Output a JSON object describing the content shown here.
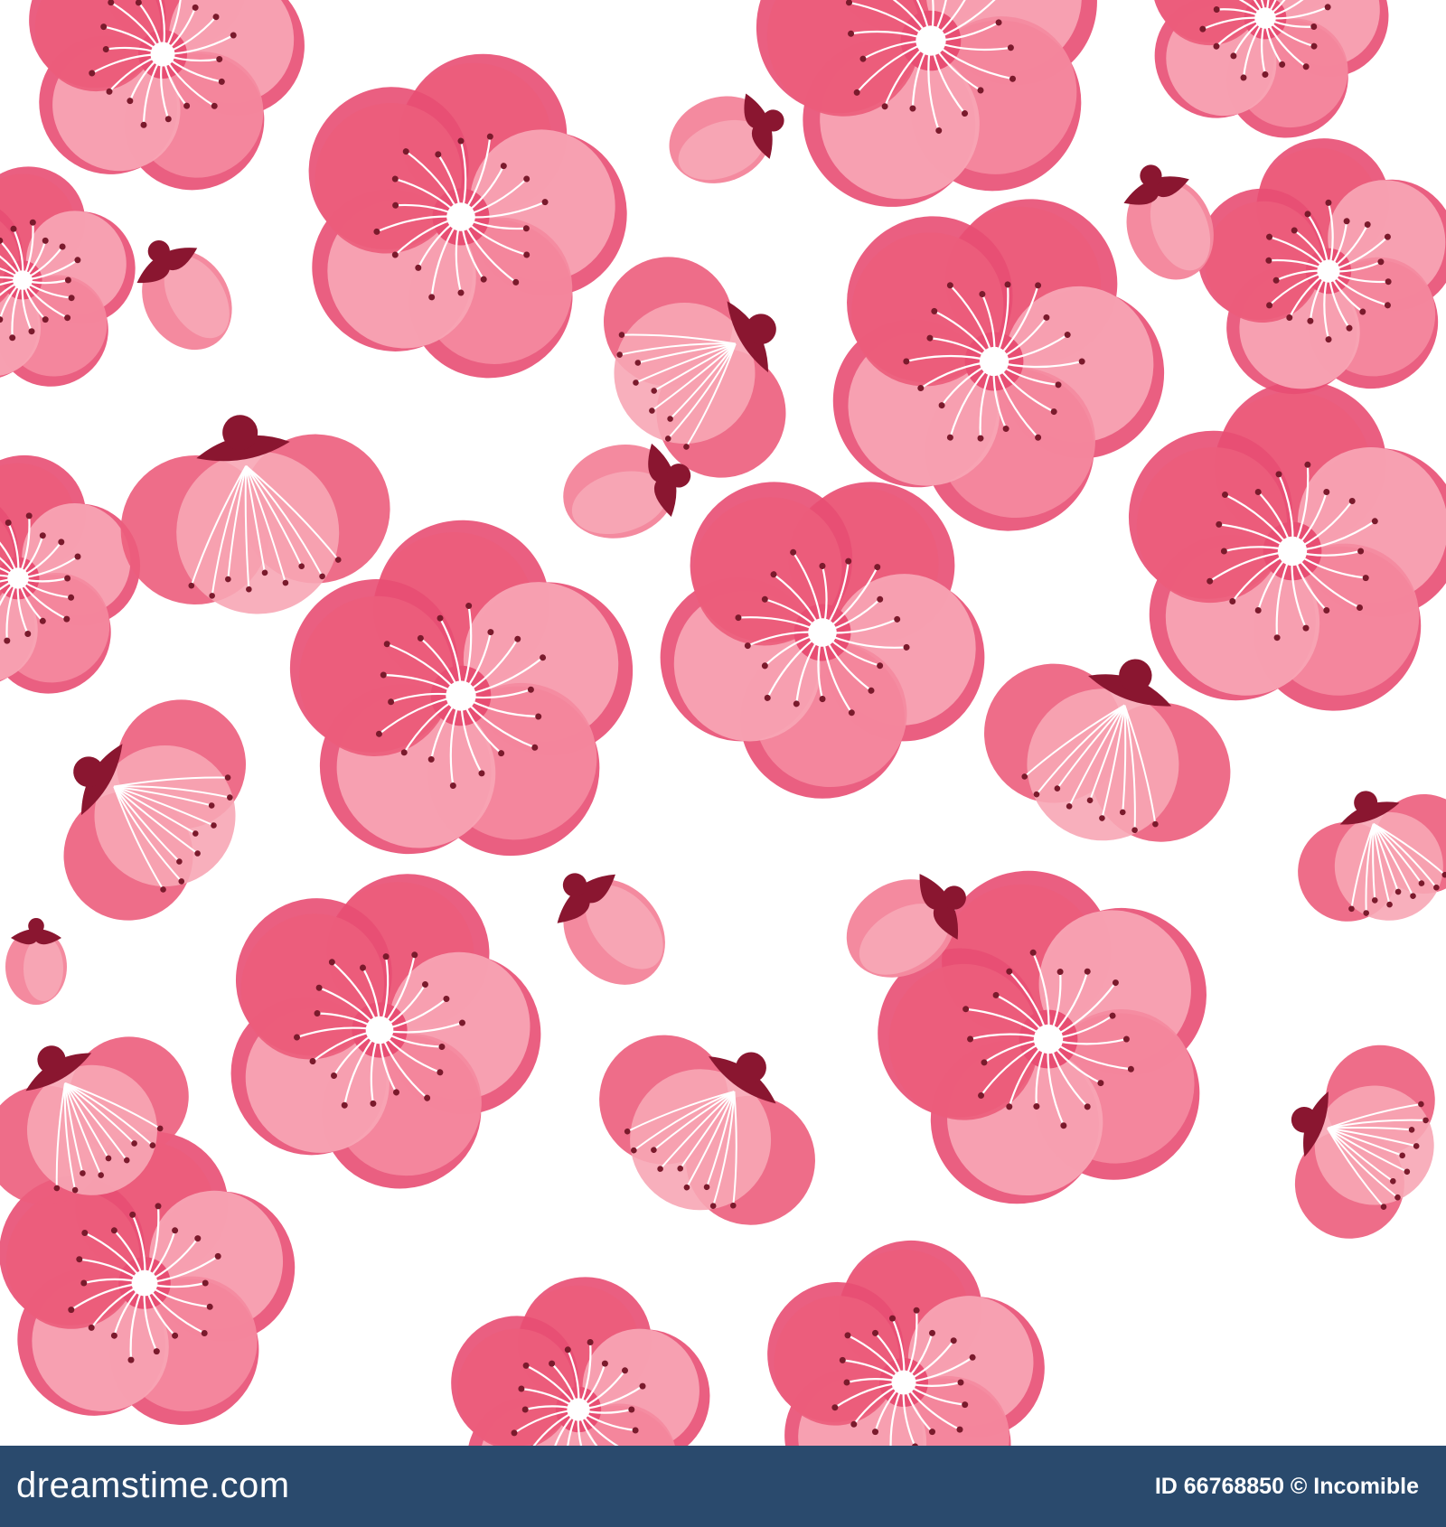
{
  "image": {
    "subject": "seamless pattern of pink blossoms and buds on white background",
    "colors": {
      "background": "#ffffff",
      "petal_light": "#f7a6b5",
      "petal_mid": "#f48a9f",
      "petal_dark": "#ec5d7c",
      "petal_edge": "#e84e73",
      "center": "#ffffff",
      "stamen": "#ffffff",
      "anther": "#7a1a2c",
      "sepal": "#8a1630",
      "footer_bg": "#2a4a6d",
      "footer_text": "#ffffff"
    }
  },
  "footer": {
    "brand": "dreamstime.com",
    "image_id": "ID 66768850 © Incomible"
  }
}
